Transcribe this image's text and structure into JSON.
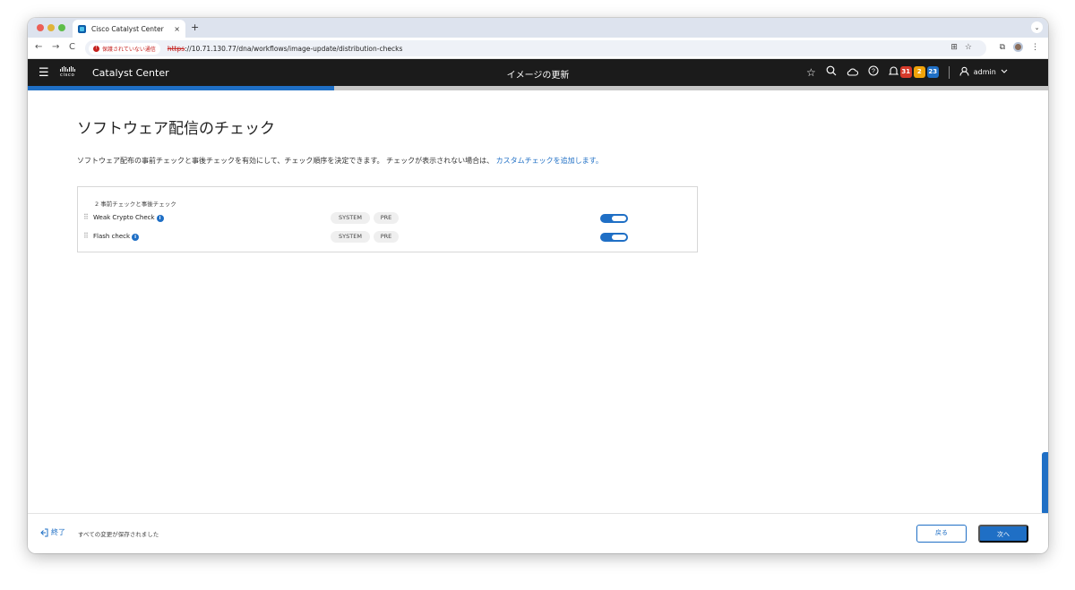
{
  "browser": {
    "tab_title": "Cisco Catalyst Center",
    "tab_close": "×",
    "new_tab": "+",
    "tab_menu": "⌄",
    "nav_back": "←",
    "nav_forward": "→",
    "nav_reload": "C",
    "insecure_label": "保護されていない通信",
    "url_scheme": "https",
    "url_rest": "://10.71.130.77/dna/workflows/image-update/distribution-checks",
    "icons": [
      "translate-icon",
      "bookmark-star-icon",
      "extensions-icon",
      "profile-avatar",
      "more-menu-icon"
    ]
  },
  "header": {
    "menu_icon": "☰",
    "logo_text": "cisco",
    "product_name": "Catalyst Center",
    "page_heading": "イメージの更新",
    "icons": [
      "star-icon",
      "search-icon",
      "cloud-icon",
      "help-icon",
      "bell-icon"
    ],
    "badges": [
      {
        "value": "31",
        "color": "#d63a2a",
        "text_color": "#ffffff"
      },
      {
        "value": "2",
        "color": "#f0a30a",
        "text_color": "#ffffff"
      },
      {
        "value": "23",
        "color": "#1f6fc5",
        "text_color": "#ffffff"
      }
    ],
    "user_name": "admin"
  },
  "progress": {
    "fraction": 0.3
  },
  "main": {
    "title": "ソフトウェア配信のチェック",
    "description": "ソフトウェア配布の事前チェックと事後チェックを有効にして、チェック順序を決定できます。 チェックが表示されない場合は、",
    "description_link": "カスタムチェックを追加します。",
    "panel": {
      "header": "2 事前チェックと事後チェック",
      "checks": [
        {
          "name": "Weak Crypto Check",
          "tag_source": "SYSTEM",
          "tag_phase": "PRE",
          "enabled": true
        },
        {
          "name": "Flash check",
          "tag_source": "SYSTEM",
          "tag_phase": "PRE",
          "enabled": true
        }
      ]
    }
  },
  "footer": {
    "exit_label": "終了",
    "save_status": "すべての変更が保存されました",
    "back_label": "戻る",
    "next_label": "次へ"
  },
  "colors": {
    "accent": "#1f6fc5",
    "header_bg": "#1b1b1b"
  }
}
